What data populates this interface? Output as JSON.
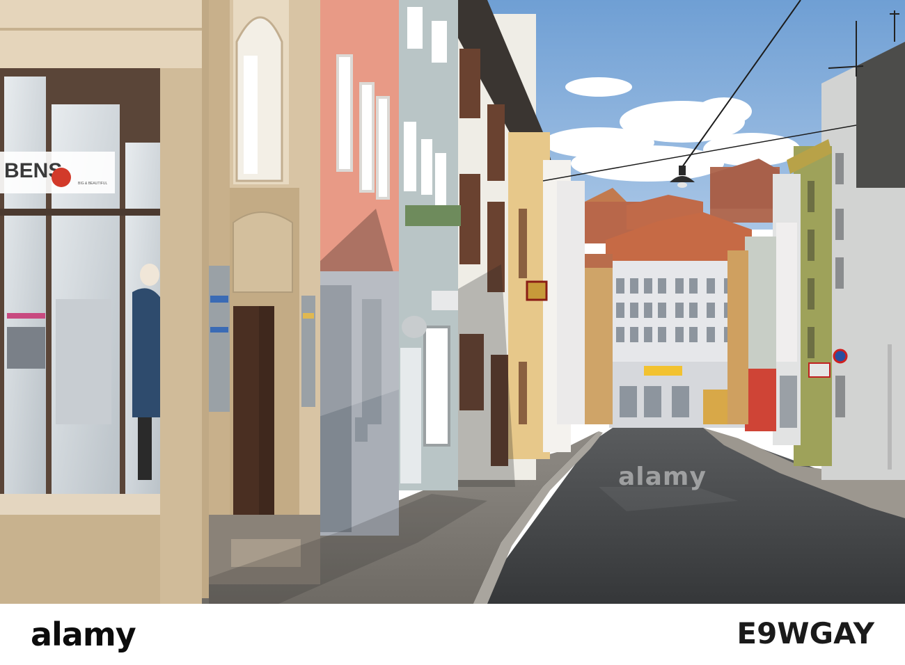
{
  "photo": {
    "description_colors": {
      "sky": "#7ea7d6",
      "road": "#3f4245",
      "sidewalk": "#8e8a84"
    },
    "signs": {
      "shop_name": "BENS",
      "shop_tagline": "BIG & BEAUTIFUL"
    }
  },
  "watermark": {
    "text": "alamy"
  },
  "footer": {
    "logo": "alamy",
    "image_id": "E9WGAY"
  }
}
